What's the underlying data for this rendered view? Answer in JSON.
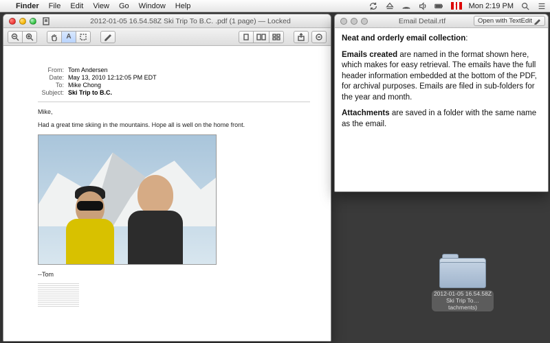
{
  "menubar": {
    "app": "Finder",
    "items": [
      "File",
      "Edit",
      "View",
      "Go",
      "Window",
      "Help"
    ],
    "clock": "Mon 2:19 PM"
  },
  "preview": {
    "title": "2012-01-05 16.54.58Z  Ski Trip To B.C. .pdf (1 page) — Locked",
    "email": {
      "from_label": "From:",
      "from": "Tom Andersen",
      "date_label": "Date:",
      "date": "May 13, 2010 12:12:05 PM EDT",
      "to_label": "To:",
      "to": "Mike Chong",
      "subject_label": "Subject:",
      "subject": "Ski Trip to B.C.",
      "greeting": "Mike,",
      "body": "Had a great time skiing in the mountains. Hope all is well on the home front.",
      "signoff": "--Tom"
    }
  },
  "textedit": {
    "title": "Email Detail.rtf",
    "open_button": "Open with TextEdit",
    "h1_bold": "Neat and orderly email collection",
    "h1_tail": ":",
    "p1_bold": "Emails created",
    "p1_rest": " are named in the format shown here, which makes for easy retrieval. The emails have the full header information embedded at the bottom of the PDF, for archival purposes. Emails are filed in sub-folders for the year and month.",
    "p2_bold": "Attachments",
    "p2_rest": " are saved in a folder with the same name as the email."
  },
  "desktop_folder": {
    "line1": "2012-01-05 16.54.58Z",
    "line2": "Ski Trip To…tachments)"
  }
}
